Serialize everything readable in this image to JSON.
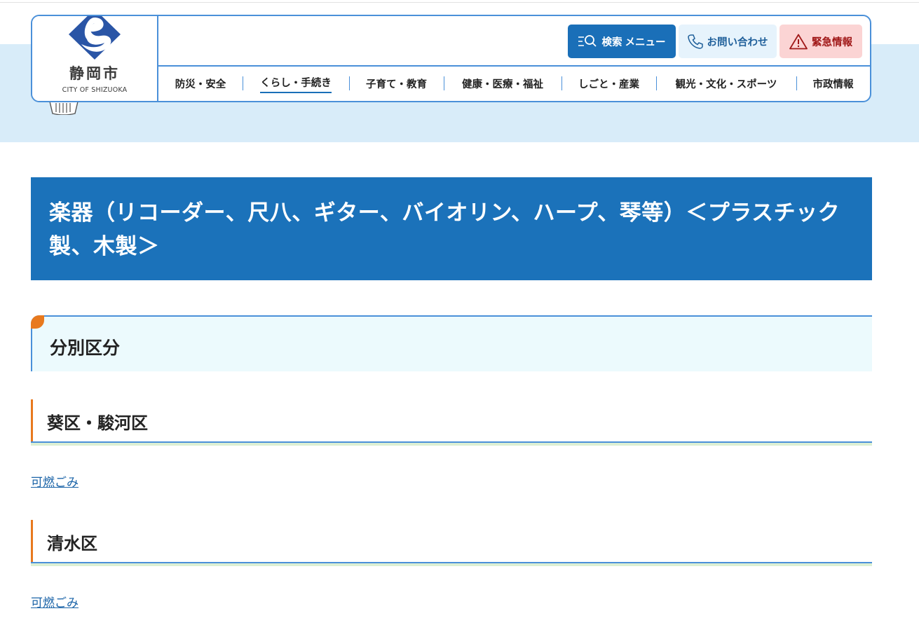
{
  "header": {
    "logo_jp": "静岡市",
    "logo_en": "CITY OF SHIZUOKA",
    "buttons": {
      "search_menu": "検索 メニュー",
      "contact": "お問い合わせ",
      "emergency": "緊急情報"
    },
    "nav": [
      {
        "label": "防災・安全"
      },
      {
        "label": "くらし・手続き"
      },
      {
        "label": "子育て・教育"
      },
      {
        "label": "健康・医療・福祉"
      },
      {
        "label": "しごと・産業"
      },
      {
        "label": "観光・文化・スポーツ"
      },
      {
        "label": "市政情報"
      }
    ],
    "current_nav": "くらし・手続き"
  },
  "page": {
    "title": "楽器（リコーダー、尺八、ギター、バイオリン、ハープ、琴等）＜プラスチック製、木製＞",
    "section_heading": "分別区分",
    "districts": [
      {
        "name": "葵区・駿河区",
        "link": "可燃ごみ"
      },
      {
        "name": "清水区",
        "link": "可燃ごみ"
      }
    ]
  },
  "colors": {
    "primary": "#1b72ba",
    "accent": "#e8791e",
    "border": "#4a90d9",
    "emergency": "#a01818"
  }
}
